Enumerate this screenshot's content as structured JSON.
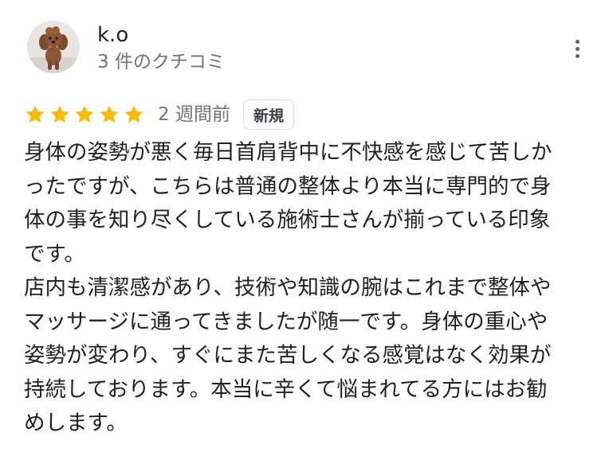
{
  "author": {
    "name": "k.o",
    "review_count": "3 件のクチコミ",
    "avatar_icon": "poodle-dog-avatar-icon"
  },
  "rating": {
    "stars": 5,
    "max": 5,
    "star_color": "#fbbc04",
    "date": "2 週間前",
    "badge": "新規"
  },
  "review": {
    "lines": [
      "身体の姿勢が悪く毎日首肩背中に不快感を感じて苦しか",
      "ったですが、こちらは普通の整体より本当に専門的で身",
      "体の事を知り尽くしている施術士さんが揃っている印象",
      "です。",
      "店内も清潔感があり、技術や知識の腕はこれまで整体や",
      "マッサージに通ってきましたが随一です。身体の重心や",
      "姿勢が変わり、すぐにまた苦しくなる感覚はなく効果が",
      "持続しております。本当に辛くて悩まれてる方にはお勧",
      "めします。"
    ]
  },
  "menu": {
    "icon": "more-vert-icon"
  }
}
